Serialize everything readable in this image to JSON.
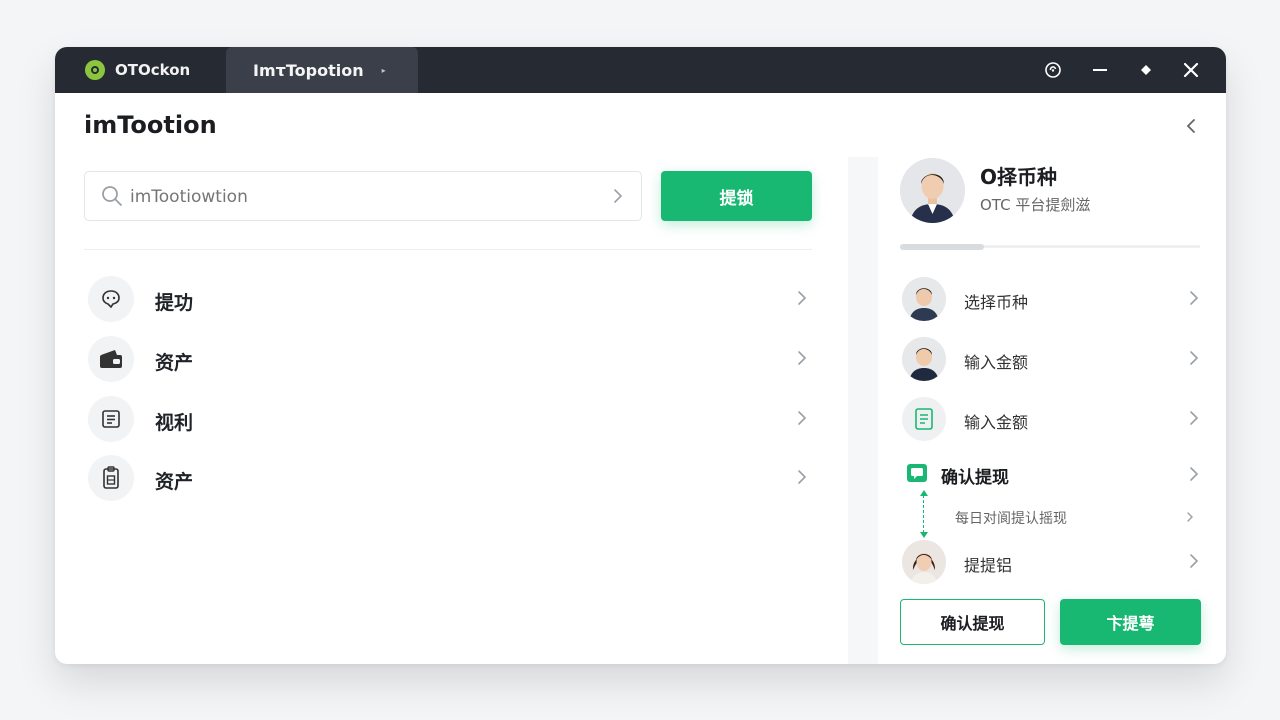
{
  "titlebar": {
    "app_name": "OTOckon",
    "tab_label": "ImτTopotion",
    "tab_arrow": "▸"
  },
  "page": {
    "title": "imTootion"
  },
  "search": {
    "placeholder": "imTootiowtion",
    "action_label": "提锁"
  },
  "menu": {
    "items": [
      {
        "label": "提功",
        "icon": "chat-bubble-icon"
      },
      {
        "label": "资产",
        "icon": "wallet-icon"
      },
      {
        "label": "视利",
        "icon": "list-document-icon"
      },
      {
        "label": "资产",
        "icon": "clipboard-icon"
      }
    ]
  },
  "profile": {
    "name": "O择币种",
    "subtitle": "OTC 平台提劍滋",
    "progress": 0.28
  },
  "steps": {
    "items": [
      {
        "label": "选择币种",
        "icon": "user-avatar"
      },
      {
        "label": "输入金额",
        "icon": "user-avatar"
      },
      {
        "label": "输入金额",
        "icon": "document-icon"
      }
    ],
    "confirm_label": "确认提现",
    "note": "每日对阆提认摇现",
    "last_label": "提提铝"
  },
  "actions": {
    "confirm_label": "确认提现",
    "submit_label": "卞提萼"
  },
  "colors": {
    "accent": "#19b872",
    "titlebar": "#262a33",
    "logo": "#8cc63f"
  }
}
